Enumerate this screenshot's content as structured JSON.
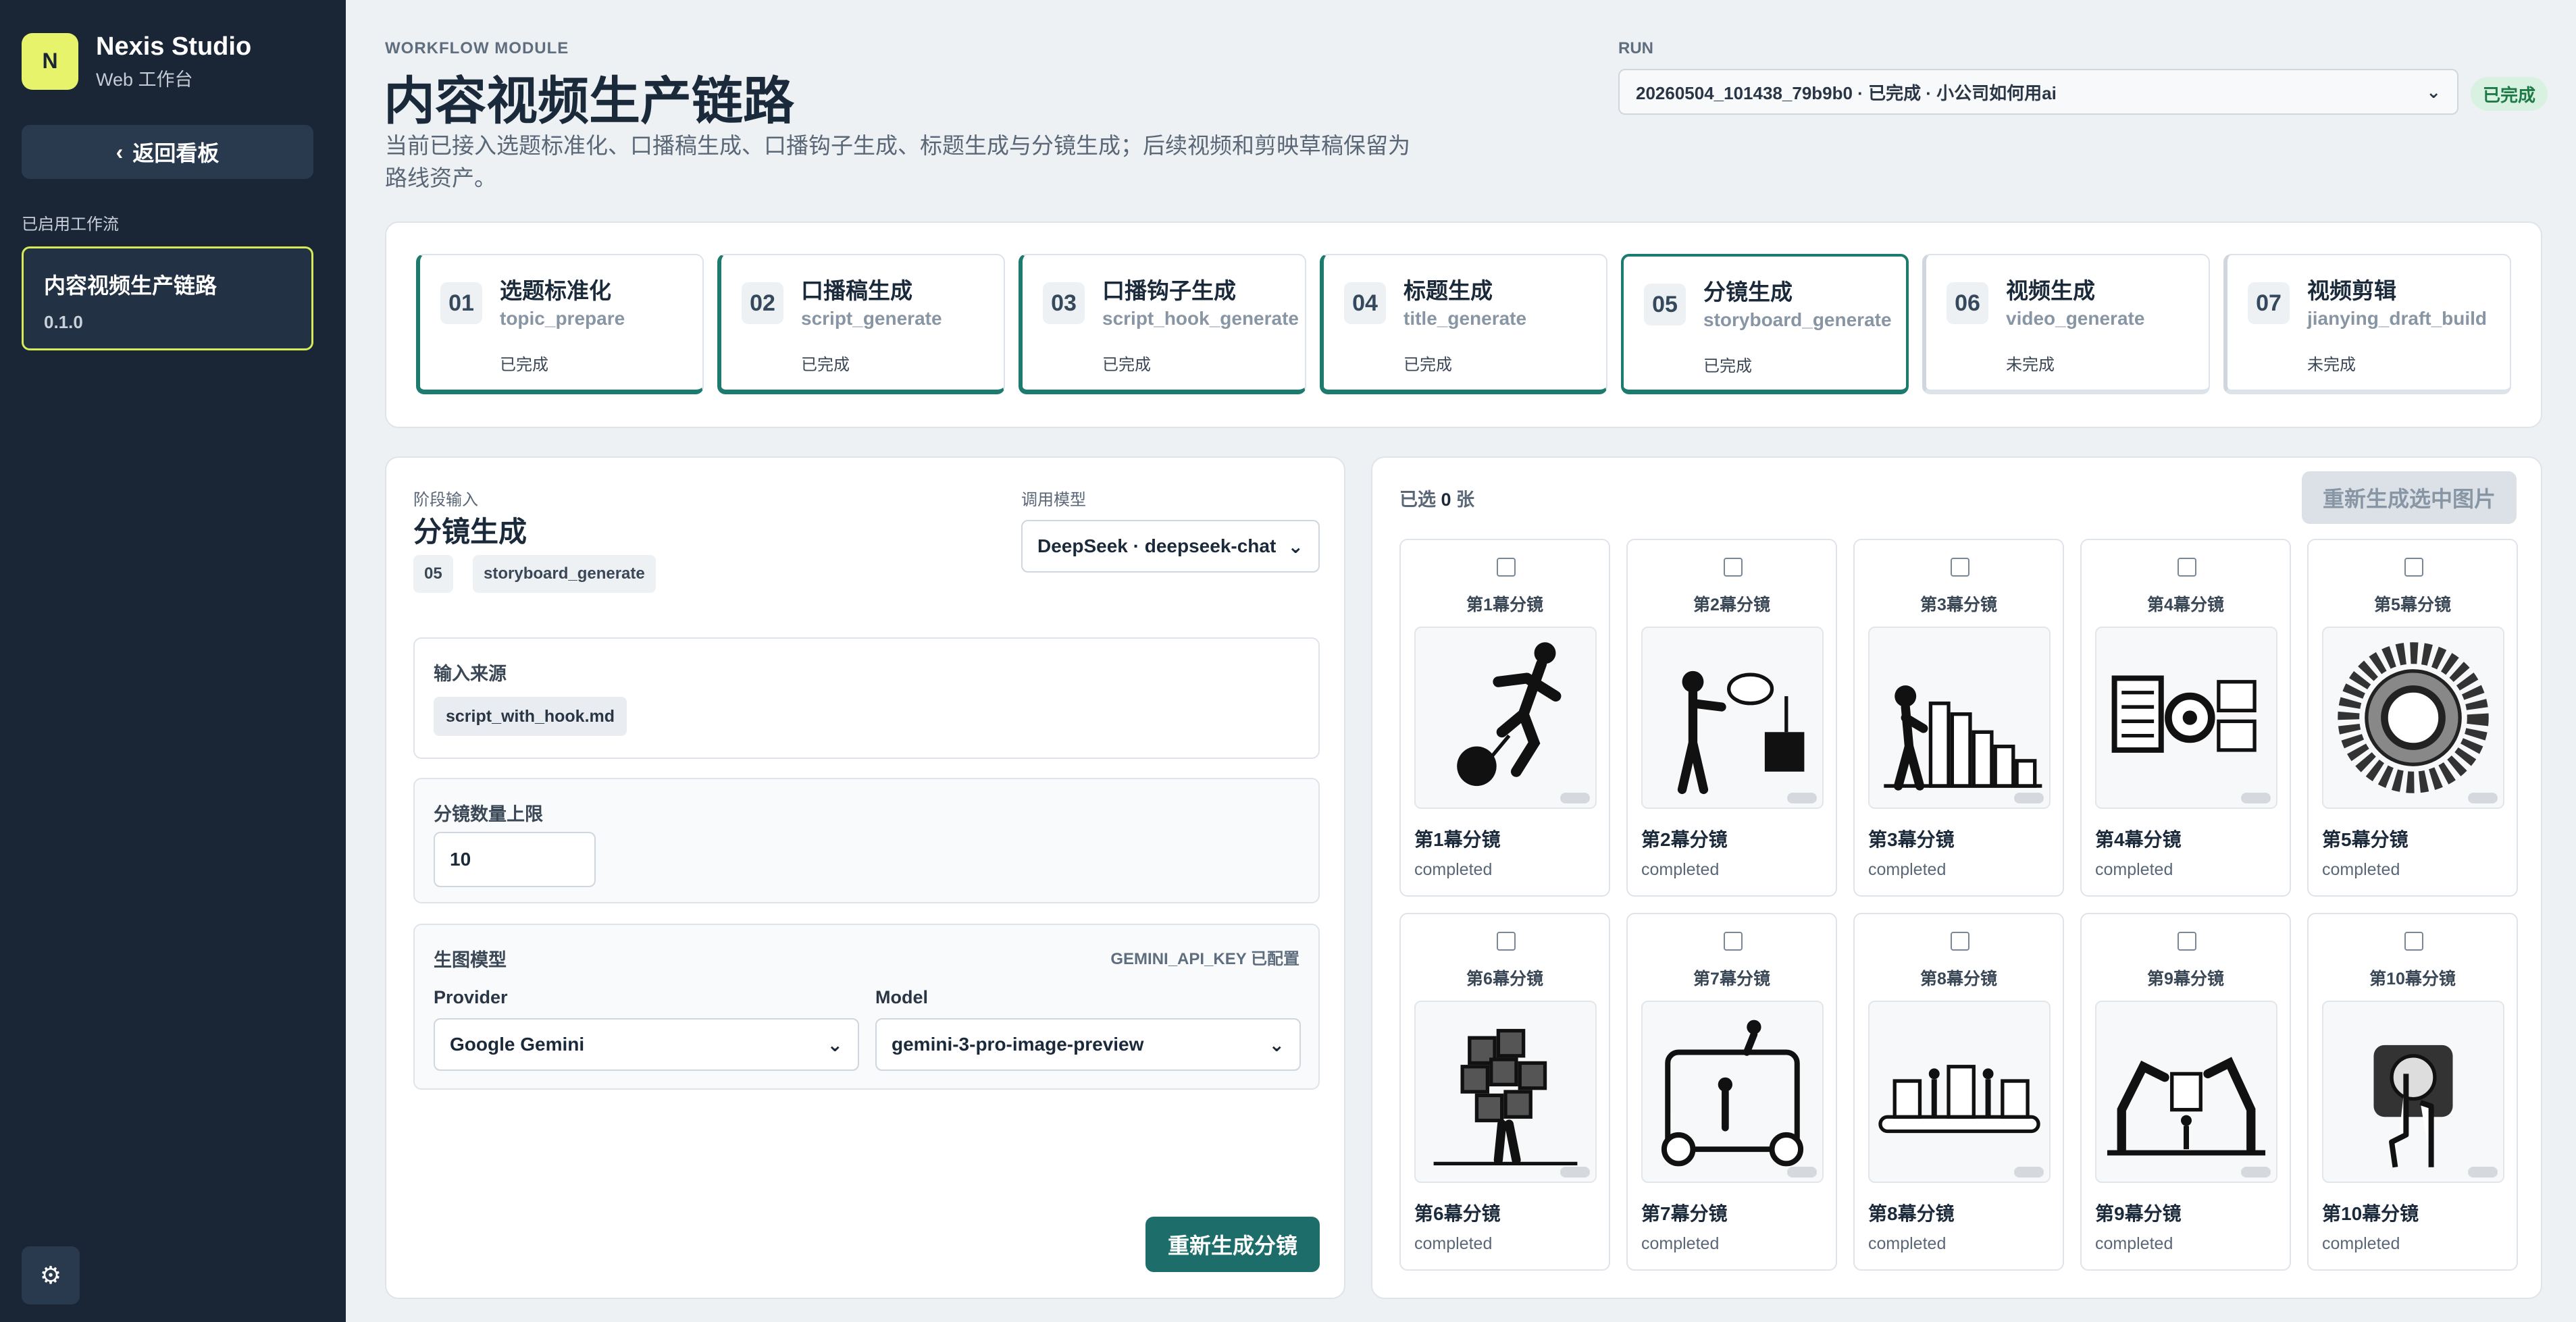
{
  "brand": {
    "logo_letter": "N",
    "name": "Nexis Studio",
    "subtitle": "Web 工作台"
  },
  "sidebar": {
    "back_label": "返回看板",
    "section_label": "已启用工作流",
    "workflow": {
      "name": "内容视频生产链路",
      "version": "0.1.0"
    }
  },
  "header": {
    "module_tag": "WORKFLOW MODULE",
    "title": "内容视频生产链路",
    "description": "当前已接入选题标准化、口播稿生成、口播钩子生成、标题生成与分镜生成；后续视频和剪映草稿保留为路线资产。",
    "run_label": "RUN",
    "run_value": "20260504_101438_79b9b0 · 已完成 · 小公司如何用ai",
    "run_badge": "已完成"
  },
  "steps": [
    {
      "num": "01",
      "name": "选题标准化",
      "code": "topic_prepare",
      "status": "已完成"
    },
    {
      "num": "02",
      "name": "口播稿生成",
      "code": "script_generate",
      "status": "已完成"
    },
    {
      "num": "03",
      "name": "口播钩子生成",
      "code": "script_hook_generate",
      "status": "已完成"
    },
    {
      "num": "04",
      "name": "标题生成",
      "code": "title_generate",
      "status": "已完成"
    },
    {
      "num": "05",
      "name": "分镜生成",
      "code": "storyboard_generate",
      "status": "已完成"
    },
    {
      "num": "06",
      "name": "视频生成",
      "code": "video_generate",
      "status": "未完成"
    },
    {
      "num": "07",
      "name": "视频剪辑",
      "code": "jianying_draft_build",
      "status": "未完成"
    }
  ],
  "form": {
    "stage_label": "阶段输入",
    "stage_title": "分镜生成",
    "stage_num": "05",
    "stage_code": "storyboard_generate",
    "model_label": "调用模型",
    "model_value": "DeepSeek · deepseek-chat",
    "input_source_label": "输入来源",
    "input_source_value": "script_with_hook.md",
    "limit_label": "分镜数量上限",
    "limit_value": "10",
    "image_model_label": "生图模型",
    "api_key_note": "GEMINI_API_KEY 已配置",
    "provider_label": "Provider",
    "provider_value": "Google Gemini",
    "model_field_label": "Model",
    "model_field_value": "gemini-3-pro-image-preview",
    "regen_button": "重新生成分镜"
  },
  "gallery": {
    "selected_prefix": "已选 ",
    "selected_count": "0",
    "selected_suffix": " 张",
    "regen_button": "重新生成选中图片",
    "cards": [
      {
        "top": "第1幕分镜",
        "title": "第1幕分镜",
        "status": "completed",
        "icon": "runner-ball-chain-icon"
      },
      {
        "top": "第2幕分镜",
        "title": "第2幕分镜",
        "status": "completed",
        "icon": "person-speech-box-icon"
      },
      {
        "top": "第3幕分镜",
        "title": "第3幕分镜",
        "status": "completed",
        "icon": "person-bar-chart-icon"
      },
      {
        "top": "第4幕分镜",
        "title": "第4幕分镜",
        "status": "completed",
        "icon": "documents-gear-icon"
      },
      {
        "top": "第5幕分镜",
        "title": "第5幕分镜",
        "status": "completed",
        "icon": "gear-ring-icon"
      },
      {
        "top": "第6幕分镜",
        "title": "第6幕分镜",
        "status": "completed",
        "icon": "person-money-boxes-icon"
      },
      {
        "top": "第7幕分镜",
        "title": "第7幕分镜",
        "status": "completed",
        "icon": "machine-workers-icon"
      },
      {
        "top": "第8幕分镜",
        "title": "第8幕分镜",
        "status": "completed",
        "icon": "assembly-line-icon"
      },
      {
        "top": "第9幕分镜",
        "title": "第9幕分镜",
        "status": "completed",
        "icon": "robot-arms-icon"
      },
      {
        "top": "第10幕分镜",
        "title": "第10幕分镜",
        "status": "completed",
        "icon": "hand-pressing-button-icon"
      }
    ]
  }
}
